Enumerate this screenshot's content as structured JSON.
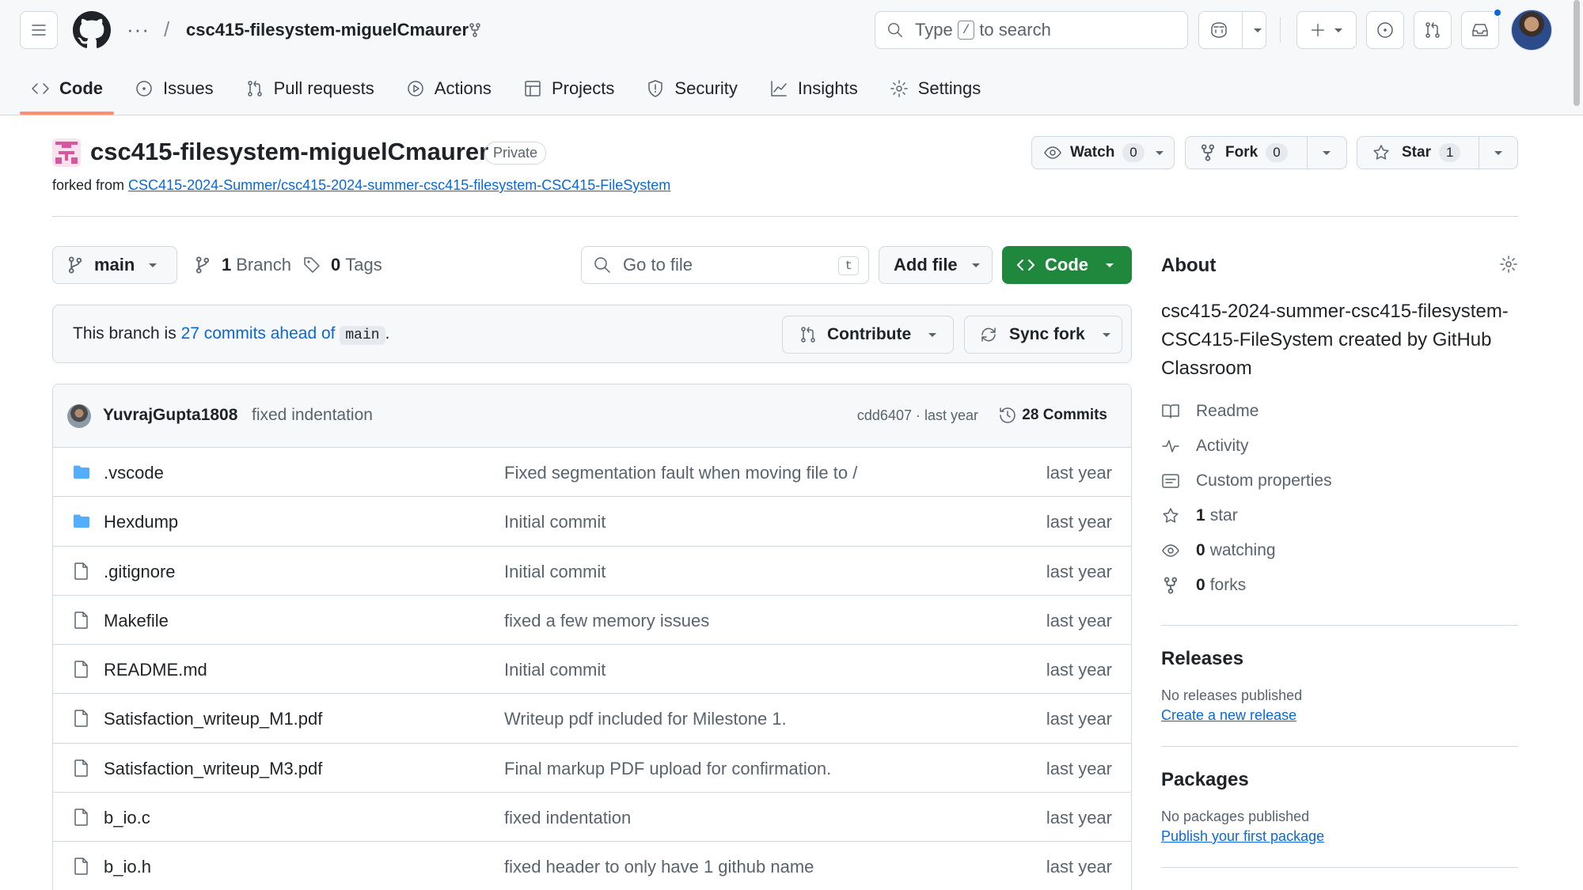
{
  "header": {
    "repo_name": "csc415-filesystem-miguelCmaurer",
    "dots": "···",
    "slash": "/",
    "search_prefix": "Type",
    "search_key": "/",
    "search_suffix": "to search"
  },
  "tabs": [
    {
      "label": "Code",
      "icon": "code-icon",
      "active": true
    },
    {
      "label": "Issues",
      "icon": "issue-icon"
    },
    {
      "label": "Pull requests",
      "icon": "pull-request-icon"
    },
    {
      "label": "Actions",
      "icon": "play-icon"
    },
    {
      "label": "Projects",
      "icon": "table-icon"
    },
    {
      "label": "Security",
      "icon": "shield-icon"
    },
    {
      "label": "Insights",
      "icon": "graph-icon"
    },
    {
      "label": "Settings",
      "icon": "gear-icon"
    }
  ],
  "repo": {
    "title": "csc415-filesystem-miguelCmaurer",
    "visibility": "Private",
    "forked_from_label": "forked from",
    "forked_from": "CSC415-2024-Summer/csc415-2024-summer-csc415-filesystem-CSC415-FileSystem",
    "watch_label": "Watch",
    "watch_count": "0",
    "fork_label": "Fork",
    "fork_count": "0",
    "star_label": "Star",
    "star_count": "1"
  },
  "branchbar": {
    "branch": "main",
    "branches_count": "1",
    "branches_label": "Branch",
    "tags_count": "0",
    "tags_label": "Tags",
    "goto_placeholder": "Go to file",
    "goto_key": "t",
    "add_file": "Add file",
    "code_button": "Code"
  },
  "ahead": {
    "prefix": "This branch is",
    "link": "27 commits ahead of",
    "base": "main",
    "suffix": ".",
    "contribute": "Contribute",
    "sync": "Sync fork"
  },
  "latest_commit": {
    "author": "YuvrajGupta1808",
    "message": "fixed indentation",
    "sha_time": "cdd6407 · last year",
    "commits": "28 Commits"
  },
  "files": [
    {
      "name": ".vscode",
      "type": "folder",
      "message": "Fixed segmentation fault when moving file to /",
      "date": "last year"
    },
    {
      "name": "Hexdump",
      "type": "folder",
      "message": "Initial commit",
      "date": "last year"
    },
    {
      "name": ".gitignore",
      "type": "file",
      "message": "Initial commit",
      "date": "last year"
    },
    {
      "name": "Makefile",
      "type": "file",
      "message": "fixed a few memory issues",
      "date": "last year"
    },
    {
      "name": "README.md",
      "type": "file",
      "message": "Initial commit",
      "date": "last year"
    },
    {
      "name": "Satisfaction_writeup_M1.pdf",
      "type": "file",
      "message": "Writeup pdf included for Milestone 1.",
      "date": "last year"
    },
    {
      "name": "Satisfaction_writeup_M3.pdf",
      "type": "file",
      "message": "Final markup PDF upload for confirmation.",
      "date": "last year"
    },
    {
      "name": "b_io.c",
      "type": "file",
      "message": "fixed indentation",
      "date": "last year"
    },
    {
      "name": "b_io.h",
      "type": "file",
      "message": "fixed header to only have 1 github name",
      "date": "last year"
    }
  ],
  "about": {
    "title": "About",
    "description": "csc415-2024-summer-csc415-filesystem-CSC415-FileSystem created by GitHub Classroom",
    "readme": "Readme",
    "activity": "Activity",
    "custom_properties": "Custom properties",
    "stars_count": "1",
    "stars_label": "star",
    "watching_count": "0",
    "watching_label": "watching",
    "forks_count": "0",
    "forks_label": "forks"
  },
  "releases": {
    "title": "Releases",
    "empty": "No releases published",
    "link": "Create a new release"
  },
  "packages": {
    "title": "Packages",
    "empty": "No packages published",
    "link": "Publish your first package"
  },
  "colors": {
    "accent": "#0969da",
    "primary_button": "#1f883d",
    "tab_underline": "#fd8c73",
    "folder": "#54aeff"
  }
}
